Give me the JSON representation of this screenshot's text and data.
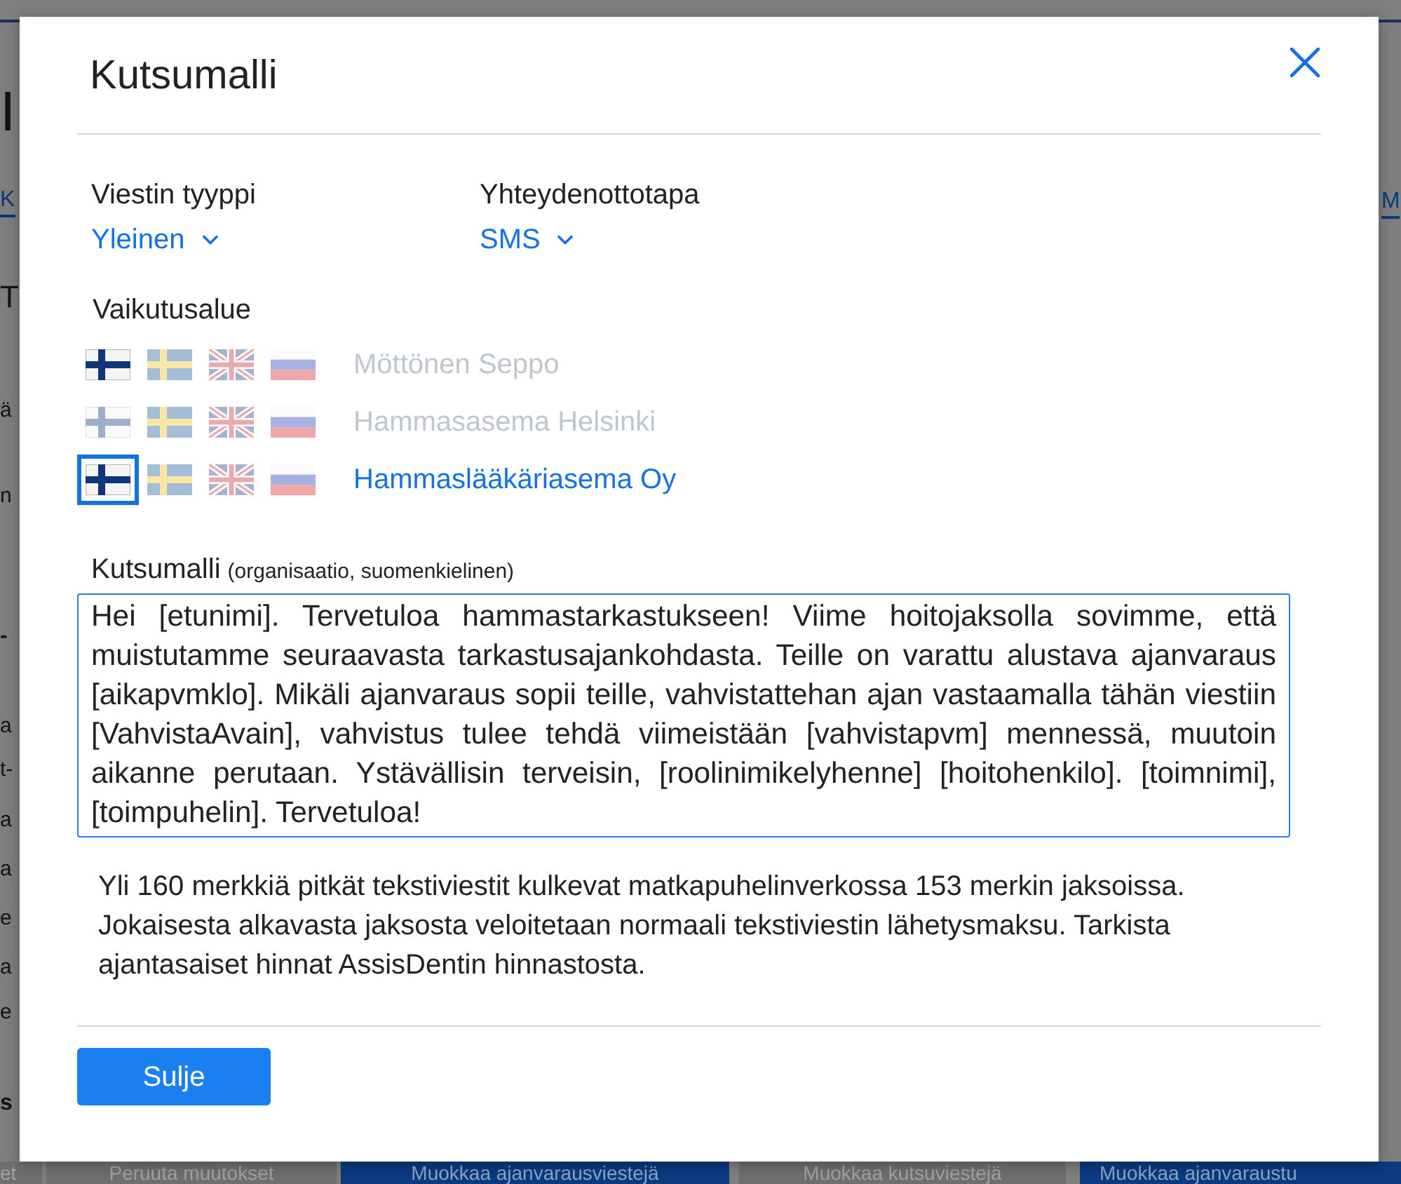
{
  "background_page": {
    "left_fragments": [
      {
        "kind": "title",
        "text": "I"
      },
      {
        "kind": "tab",
        "text": "K"
      },
      {
        "kind": "heading",
        "text": "T"
      },
      {
        "kind": "text",
        "text": "ä"
      },
      {
        "kind": "text",
        "text": "n"
      },
      {
        "kind": "bold",
        "text": "-"
      },
      {
        "kind": "text",
        "text": "a"
      },
      {
        "kind": "text",
        "text": "t-"
      },
      {
        "kind": "text",
        "text": "a"
      },
      {
        "kind": "text",
        "text": "a"
      },
      {
        "kind": "text",
        "text": "e"
      },
      {
        "kind": "text",
        "text": "a"
      },
      {
        "kind": "text",
        "text": "e"
      },
      {
        "kind": "bold",
        "text": "s"
      }
    ],
    "right_fragments": [
      {
        "kind": "tab",
        "text": "M"
      }
    ],
    "bottom_buttons": [
      {
        "label": "et",
        "kind": "secondary"
      },
      {
        "label": "Peruuta muutokset",
        "kind": "secondary"
      },
      {
        "label": "Muokkaa ajanvarausviestejä",
        "kind": "primary"
      },
      {
        "label": "Muokkaa kutsuviestejä",
        "kind": "secondary"
      },
      {
        "label": "Muokkaa ajanvaraustu",
        "kind": "primary"
      }
    ]
  },
  "dialog": {
    "title": "Kutsumalli",
    "fields": [
      {
        "label": "Viestin tyyppi",
        "value": "Yleinen"
      },
      {
        "label": "Yhteydenottotapa",
        "value": "SMS"
      }
    ],
    "scope": {
      "label": "Vaikutusalue",
      "rows": [
        {
          "name": "Möttönen Seppo",
          "selected": false,
          "flags": [
            {
              "kind": "fi",
              "active": true,
              "selected": false
            },
            {
              "kind": "sv",
              "active": false,
              "selected": false
            },
            {
              "kind": "en",
              "active": false,
              "selected": false
            },
            {
              "kind": "ru",
              "active": false,
              "selected": false
            }
          ]
        },
        {
          "name": "Hammasasema Helsinki",
          "selected": false,
          "flags": [
            {
              "kind": "fi",
              "active": false,
              "selected": false
            },
            {
              "kind": "sv",
              "active": false,
              "selected": false
            },
            {
              "kind": "en",
              "active": false,
              "selected": false
            },
            {
              "kind": "ru",
              "active": false,
              "selected": false
            }
          ]
        },
        {
          "name": "Hammaslääkäriasema Oy",
          "selected": true,
          "flags": [
            {
              "kind": "fi",
              "active": true,
              "selected": true
            },
            {
              "kind": "sv",
              "active": false,
              "selected": false
            },
            {
              "kind": "en",
              "active": false,
              "selected": false
            },
            {
              "kind": "ru",
              "active": false,
              "selected": false
            }
          ]
        }
      ]
    },
    "template": {
      "label": "Kutsumalli",
      "note": "(organisaatio, suomenkielinen)",
      "value": "Hei [etunimi]. Tervetuloa hammastarkastukseen! Viime hoitojaksolla sovimme, että muistutamme seuraavasta tarkastusajankohdasta. Teille on varattu alustava ajanvaraus [aikapvmklo]. Mikäli ajanvaraus sopii teille, vahvistattehan ajan vastaamalla tähän viestiin [VahvistaAvain], vahvistus tulee tehdä viimeistään [vahvistapvm] mennessä, muutoin aikanne perutaan. Ystävällisin terveisin, [roolinimikelyhenne] [hoitohenkilo]. [toimnimi], [toimpuhelin]. Tervetuloa!"
    },
    "info": "Yli 160 merkkiä pitkät tekstiviestit kulkevat matkapuhelinverkossa 153 merkin jaksoissa. Jokaisesta alkavasta jaksosta veloitetaan normaali tekstiviestin lähetysmaksu. Tarkista ajantasaiset hinnat AssisDentin hinnastosta.",
    "buttons": [
      {
        "label": "Sulje",
        "kind": "primary"
      }
    ]
  }
}
